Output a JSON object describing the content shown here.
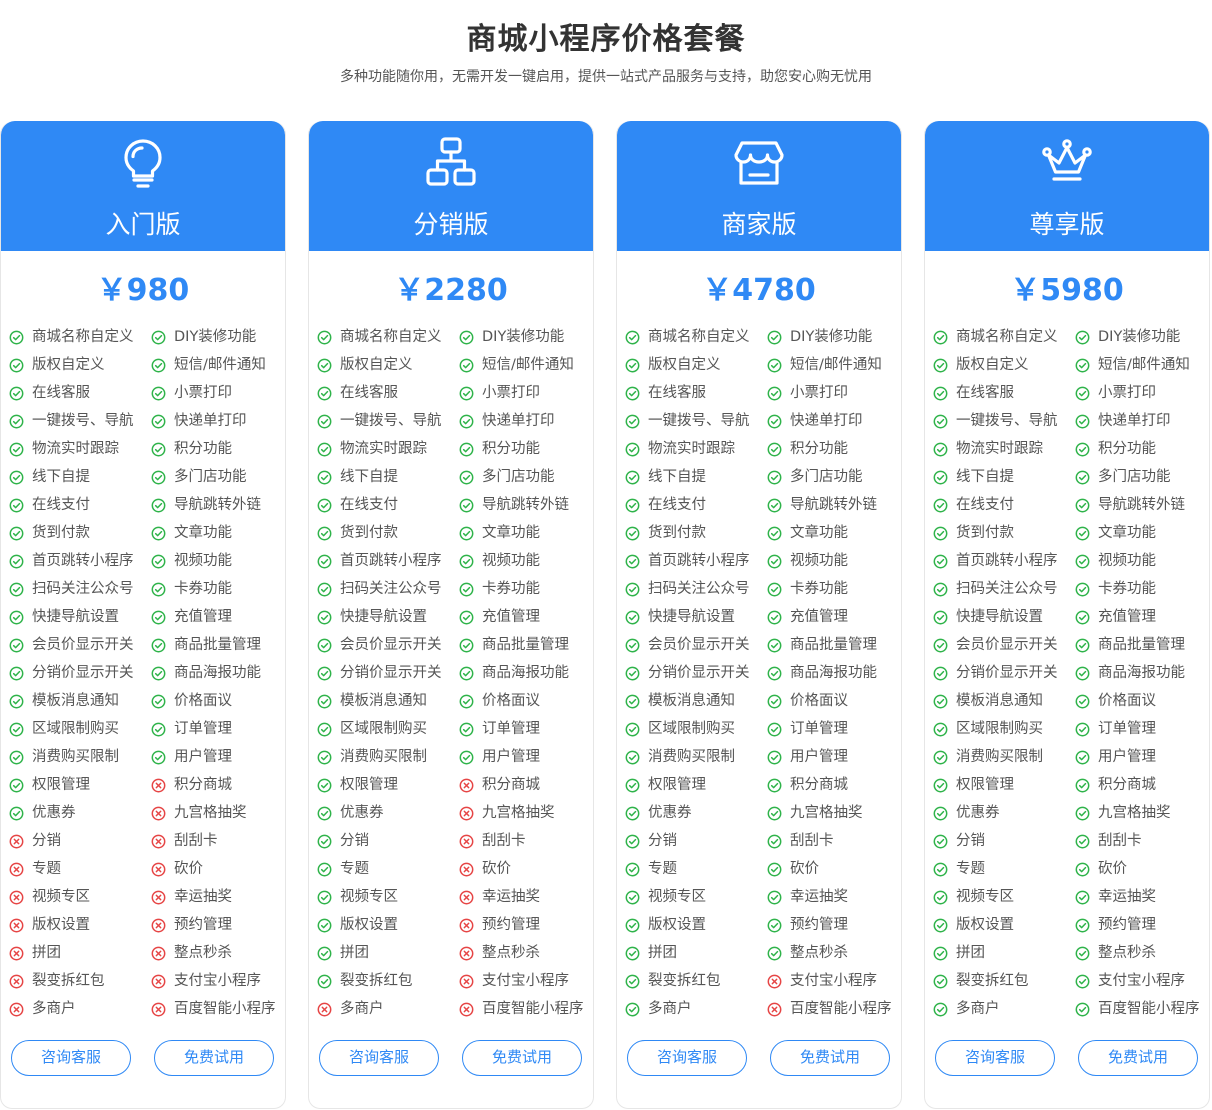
{
  "header": {
    "title": "商城小程序价格套餐",
    "subtitle": "多种功能随你用，无需开发一键启用，提供一站式产品服务与支持，助您安心购无忧用"
  },
  "colors": {
    "accent": "#2f89f5",
    "included": "#2fb34a",
    "excluded": "#e64545"
  },
  "plans": [
    {
      "name": "入门版",
      "icon": "lightbulb-icon",
      "price": "￥980",
      "consult_label": "咨询客服",
      "trial_label": "免费试用",
      "features": [
        {
          "label": "商城名称自定义",
          "included": true
        },
        {
          "label": "DIY装修功能",
          "included": true
        },
        {
          "label": "版权自定义",
          "included": true
        },
        {
          "label": "短信/邮件通知",
          "included": true
        },
        {
          "label": "在线客服",
          "included": true
        },
        {
          "label": "小票打印",
          "included": true
        },
        {
          "label": "一键拨号、导航",
          "included": true
        },
        {
          "label": "快递单打印",
          "included": true
        },
        {
          "label": "物流实时跟踪",
          "included": true
        },
        {
          "label": "积分功能",
          "included": true
        },
        {
          "label": "线下自提",
          "included": true
        },
        {
          "label": "多门店功能",
          "included": true
        },
        {
          "label": "在线支付",
          "included": true
        },
        {
          "label": "导航跳转外链",
          "included": true
        },
        {
          "label": "货到付款",
          "included": true
        },
        {
          "label": "文章功能",
          "included": true
        },
        {
          "label": "首页跳转小程序",
          "included": true
        },
        {
          "label": "视频功能",
          "included": true
        },
        {
          "label": "扫码关注公众号",
          "included": true
        },
        {
          "label": "卡券功能",
          "included": true
        },
        {
          "label": "快捷导航设置",
          "included": true
        },
        {
          "label": "充值管理",
          "included": true
        },
        {
          "label": "会员价显示开关",
          "included": true
        },
        {
          "label": "商品批量管理",
          "included": true
        },
        {
          "label": "分销价显示开关",
          "included": true
        },
        {
          "label": "商品海报功能",
          "included": true
        },
        {
          "label": "模板消息通知",
          "included": true
        },
        {
          "label": "价格面议",
          "included": true
        },
        {
          "label": "区域限制购买",
          "included": true
        },
        {
          "label": "订单管理",
          "included": true
        },
        {
          "label": "消费购买限制",
          "included": true
        },
        {
          "label": "用户管理",
          "included": true
        },
        {
          "label": "权限管理",
          "included": true
        },
        {
          "label": "积分商城",
          "included": false
        },
        {
          "label": "优惠券",
          "included": true
        },
        {
          "label": "九宫格抽奖",
          "included": false
        },
        {
          "label": "分销",
          "included": false
        },
        {
          "label": "刮刮卡",
          "included": false
        },
        {
          "label": "专题",
          "included": false
        },
        {
          "label": "砍价",
          "included": false
        },
        {
          "label": "视频专区",
          "included": false
        },
        {
          "label": "幸运抽奖",
          "included": false
        },
        {
          "label": "版权设置",
          "included": false
        },
        {
          "label": "预约管理",
          "included": false
        },
        {
          "label": "拼团",
          "included": false
        },
        {
          "label": "整点秒杀",
          "included": false
        },
        {
          "label": "裂变拆红包",
          "included": false
        },
        {
          "label": "支付宝小程序",
          "included": false
        },
        {
          "label": "多商户",
          "included": false
        },
        {
          "label": "百度智能小程序",
          "included": false
        }
      ]
    },
    {
      "name": "分销版",
      "icon": "sitemap-icon",
      "price": "￥2280",
      "consult_label": "咨询客服",
      "trial_label": "免费试用",
      "features": [
        {
          "label": "商城名称自定义",
          "included": true
        },
        {
          "label": "DIY装修功能",
          "included": true
        },
        {
          "label": "版权自定义",
          "included": true
        },
        {
          "label": "短信/邮件通知",
          "included": true
        },
        {
          "label": "在线客服",
          "included": true
        },
        {
          "label": "小票打印",
          "included": true
        },
        {
          "label": "一键拨号、导航",
          "included": true
        },
        {
          "label": "快递单打印",
          "included": true
        },
        {
          "label": "物流实时跟踪",
          "included": true
        },
        {
          "label": "积分功能",
          "included": true
        },
        {
          "label": "线下自提",
          "included": true
        },
        {
          "label": "多门店功能",
          "included": true
        },
        {
          "label": "在线支付",
          "included": true
        },
        {
          "label": "导航跳转外链",
          "included": true
        },
        {
          "label": "货到付款",
          "included": true
        },
        {
          "label": "文章功能",
          "included": true
        },
        {
          "label": "首页跳转小程序",
          "included": true
        },
        {
          "label": "视频功能",
          "included": true
        },
        {
          "label": "扫码关注公众号",
          "included": true
        },
        {
          "label": "卡券功能",
          "included": true
        },
        {
          "label": "快捷导航设置",
          "included": true
        },
        {
          "label": "充值管理",
          "included": true
        },
        {
          "label": "会员价显示开关",
          "included": true
        },
        {
          "label": "商品批量管理",
          "included": true
        },
        {
          "label": "分销价显示开关",
          "included": true
        },
        {
          "label": "商品海报功能",
          "included": true
        },
        {
          "label": "模板消息通知",
          "included": true
        },
        {
          "label": "价格面议",
          "included": true
        },
        {
          "label": "区域限制购买",
          "included": true
        },
        {
          "label": "订单管理",
          "included": true
        },
        {
          "label": "消费购买限制",
          "included": true
        },
        {
          "label": "用户管理",
          "included": true
        },
        {
          "label": "权限管理",
          "included": true
        },
        {
          "label": "积分商城",
          "included": false
        },
        {
          "label": "优惠券",
          "included": true
        },
        {
          "label": "九宫格抽奖",
          "included": false
        },
        {
          "label": "分销",
          "included": true
        },
        {
          "label": "刮刮卡",
          "included": false
        },
        {
          "label": "专题",
          "included": true
        },
        {
          "label": "砍价",
          "included": false
        },
        {
          "label": "视频专区",
          "included": true
        },
        {
          "label": "幸运抽奖",
          "included": false
        },
        {
          "label": "版权设置",
          "included": true
        },
        {
          "label": "预约管理",
          "included": false
        },
        {
          "label": "拼团",
          "included": true
        },
        {
          "label": "整点秒杀",
          "included": false
        },
        {
          "label": "裂变拆红包",
          "included": true
        },
        {
          "label": "支付宝小程序",
          "included": false
        },
        {
          "label": "多商户",
          "included": false
        },
        {
          "label": "百度智能小程序",
          "included": false
        }
      ]
    },
    {
      "name": "商家版",
      "icon": "store-icon",
      "price": "￥4780",
      "consult_label": "咨询客服",
      "trial_label": "免费试用",
      "features": [
        {
          "label": "商城名称自定义",
          "included": true
        },
        {
          "label": "DIY装修功能",
          "included": true
        },
        {
          "label": "版权自定义",
          "included": true
        },
        {
          "label": "短信/邮件通知",
          "included": true
        },
        {
          "label": "在线客服",
          "included": true
        },
        {
          "label": "小票打印",
          "included": true
        },
        {
          "label": "一键拨号、导航",
          "included": true
        },
        {
          "label": "快递单打印",
          "included": true
        },
        {
          "label": "物流实时跟踪",
          "included": true
        },
        {
          "label": "积分功能",
          "included": true
        },
        {
          "label": "线下自提",
          "included": true
        },
        {
          "label": "多门店功能",
          "included": true
        },
        {
          "label": "在线支付",
          "included": true
        },
        {
          "label": "导航跳转外链",
          "included": true
        },
        {
          "label": "货到付款",
          "included": true
        },
        {
          "label": "文章功能",
          "included": true
        },
        {
          "label": "首页跳转小程序",
          "included": true
        },
        {
          "label": "视频功能",
          "included": true
        },
        {
          "label": "扫码关注公众号",
          "included": true
        },
        {
          "label": "卡券功能",
          "included": true
        },
        {
          "label": "快捷导航设置",
          "included": true
        },
        {
          "label": "充值管理",
          "included": true
        },
        {
          "label": "会员价显示开关",
          "included": true
        },
        {
          "label": "商品批量管理",
          "included": true
        },
        {
          "label": "分销价显示开关",
          "included": true
        },
        {
          "label": "商品海报功能",
          "included": true
        },
        {
          "label": "模板消息通知",
          "included": true
        },
        {
          "label": "价格面议",
          "included": true
        },
        {
          "label": "区域限制购买",
          "included": true
        },
        {
          "label": "订单管理",
          "included": true
        },
        {
          "label": "消费购买限制",
          "included": true
        },
        {
          "label": "用户管理",
          "included": true
        },
        {
          "label": "权限管理",
          "included": true
        },
        {
          "label": "积分商城",
          "included": true
        },
        {
          "label": "优惠券",
          "included": true
        },
        {
          "label": "九宫格抽奖",
          "included": true
        },
        {
          "label": "分销",
          "included": true
        },
        {
          "label": "刮刮卡",
          "included": true
        },
        {
          "label": "专题",
          "included": true
        },
        {
          "label": "砍价",
          "included": true
        },
        {
          "label": "视频专区",
          "included": true
        },
        {
          "label": "幸运抽奖",
          "included": true
        },
        {
          "label": "版权设置",
          "included": true
        },
        {
          "label": "预约管理",
          "included": true
        },
        {
          "label": "拼团",
          "included": true
        },
        {
          "label": "整点秒杀",
          "included": true
        },
        {
          "label": "裂变拆红包",
          "included": true
        },
        {
          "label": "支付宝小程序",
          "included": false
        },
        {
          "label": "多商户",
          "included": true
        },
        {
          "label": "百度智能小程序",
          "included": false
        }
      ]
    },
    {
      "name": "尊享版",
      "icon": "crown-icon",
      "price": "￥5980",
      "consult_label": "咨询客服",
      "trial_label": "免费试用",
      "features": [
        {
          "label": "商城名称自定义",
          "included": true
        },
        {
          "label": "DIY装修功能",
          "included": true
        },
        {
          "label": "版权自定义",
          "included": true
        },
        {
          "label": "短信/邮件通知",
          "included": true
        },
        {
          "label": "在线客服",
          "included": true
        },
        {
          "label": "小票打印",
          "included": true
        },
        {
          "label": "一键拨号、导航",
          "included": true
        },
        {
          "label": "快递单打印",
          "included": true
        },
        {
          "label": "物流实时跟踪",
          "included": true
        },
        {
          "label": "积分功能",
          "included": true
        },
        {
          "label": "线下自提",
          "included": true
        },
        {
          "label": "多门店功能",
          "included": true
        },
        {
          "label": "在线支付",
          "included": true
        },
        {
          "label": "导航跳转外链",
          "included": true
        },
        {
          "label": "货到付款",
          "included": true
        },
        {
          "label": "文章功能",
          "included": true
        },
        {
          "label": "首页跳转小程序",
          "included": true
        },
        {
          "label": "视频功能",
          "included": true
        },
        {
          "label": "扫码关注公众号",
          "included": true
        },
        {
          "label": "卡券功能",
          "included": true
        },
        {
          "label": "快捷导航设置",
          "included": true
        },
        {
          "label": "充值管理",
          "included": true
        },
        {
          "label": "会员价显示开关",
          "included": true
        },
        {
          "label": "商品批量管理",
          "included": true
        },
        {
          "label": "分销价显示开关",
          "included": true
        },
        {
          "label": "商品海报功能",
          "included": true
        },
        {
          "label": "模板消息通知",
          "included": true
        },
        {
          "label": "价格面议",
          "included": true
        },
        {
          "label": "区域限制购买",
          "included": true
        },
        {
          "label": "订单管理",
          "included": true
        },
        {
          "label": "消费购买限制",
          "included": true
        },
        {
          "label": "用户管理",
          "included": true
        },
        {
          "label": "权限管理",
          "included": true
        },
        {
          "label": "积分商城",
          "included": true
        },
        {
          "label": "优惠券",
          "included": true
        },
        {
          "label": "九宫格抽奖",
          "included": true
        },
        {
          "label": "分销",
          "included": true
        },
        {
          "label": "刮刮卡",
          "included": true
        },
        {
          "label": "专题",
          "included": true
        },
        {
          "label": "砍价",
          "included": true
        },
        {
          "label": "视频专区",
          "included": true
        },
        {
          "label": "幸运抽奖",
          "included": true
        },
        {
          "label": "版权设置",
          "included": true
        },
        {
          "label": "预约管理",
          "included": true
        },
        {
          "label": "拼团",
          "included": true
        },
        {
          "label": "整点秒杀",
          "included": true
        },
        {
          "label": "裂变拆红包",
          "included": true
        },
        {
          "label": "支付宝小程序",
          "included": true
        },
        {
          "label": "多商户",
          "included": true
        },
        {
          "label": "百度智能小程序",
          "included": true
        }
      ]
    }
  ]
}
